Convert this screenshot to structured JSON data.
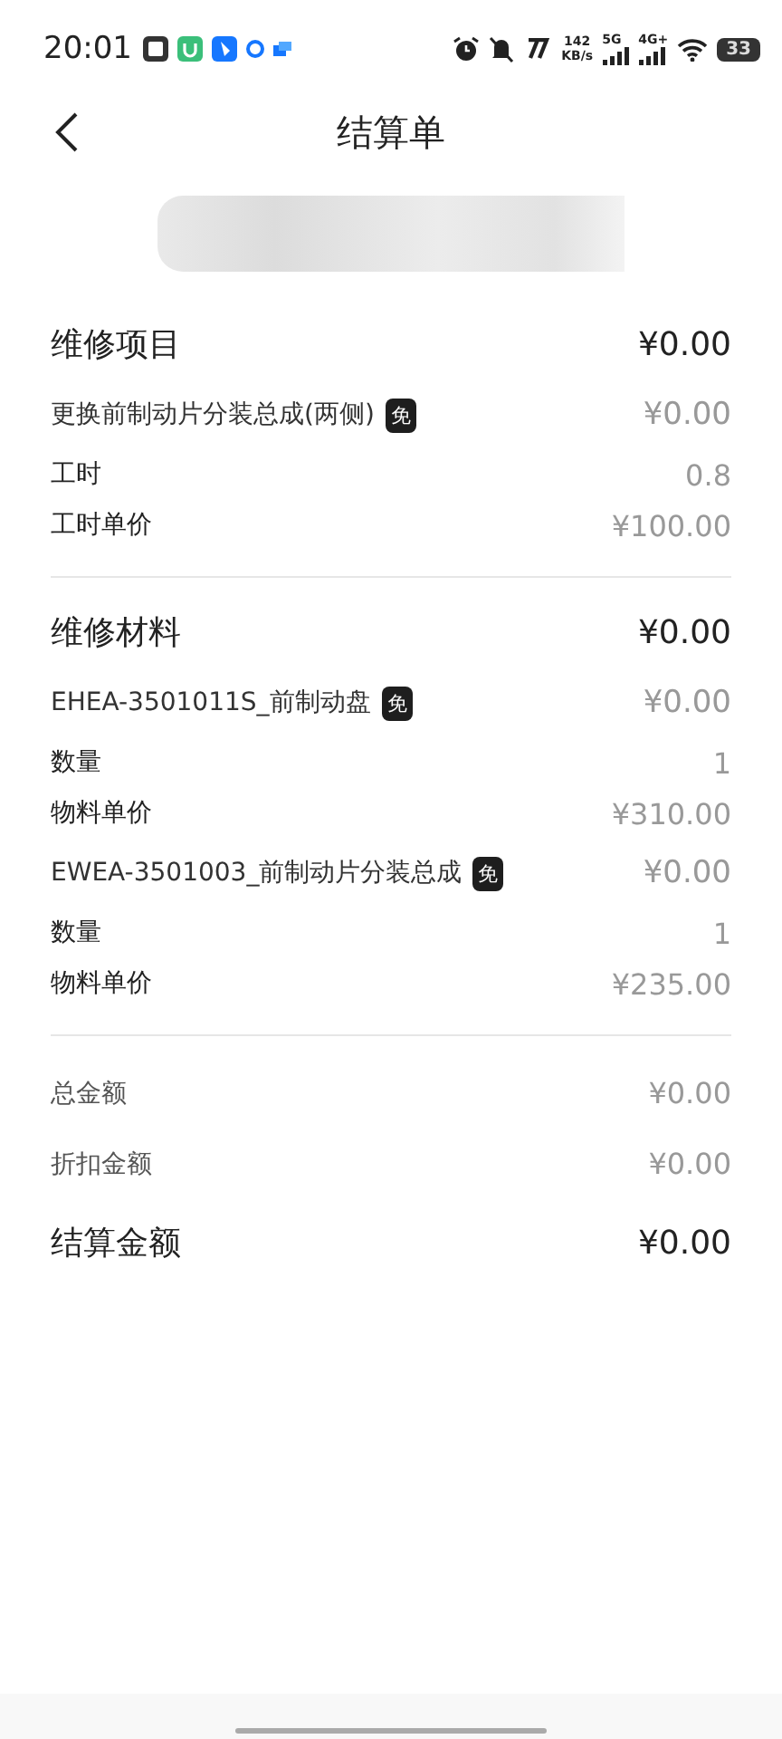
{
  "status_bar": {
    "time": "20:01",
    "speed": "142",
    "speed_unit": "KB/s",
    "network_1": "5G",
    "network_2": "4G+",
    "battery": "33"
  },
  "header": {
    "title": "结算单"
  },
  "sections": [
    {
      "title": "维修项目",
      "amount": "¥0.00",
      "items": [
        {
          "name": "更换前制动片分装总成(两侧)",
          "badge": "免",
          "amount": "¥0.00",
          "details": [
            {
              "label": "工时",
              "value": "0.8"
            },
            {
              "label": "工时单价",
              "value": "¥100.00"
            }
          ]
        }
      ]
    },
    {
      "title": "维修材料",
      "amount": "¥0.00",
      "items": [
        {
          "name": "EHEA-3501011S_前制动盘",
          "badge": "免",
          "amount": "¥0.00",
          "details": [
            {
              "label": "数量",
              "value": "1"
            },
            {
              "label": "物料单价",
              "value": "¥310.00"
            }
          ]
        },
        {
          "name": "EWEA-3501003_前制动片分装总成",
          "badge": "免",
          "amount": "¥0.00",
          "details": [
            {
              "label": "数量",
              "value": "1"
            },
            {
              "label": "物料单价",
              "value": "¥235.00"
            }
          ]
        }
      ]
    }
  ],
  "summary": [
    {
      "label": "总金额",
      "value": "¥0.00"
    },
    {
      "label": "折扣金额",
      "value": "¥0.00"
    }
  ],
  "total": {
    "label": "结算金额",
    "value": "¥0.00"
  }
}
